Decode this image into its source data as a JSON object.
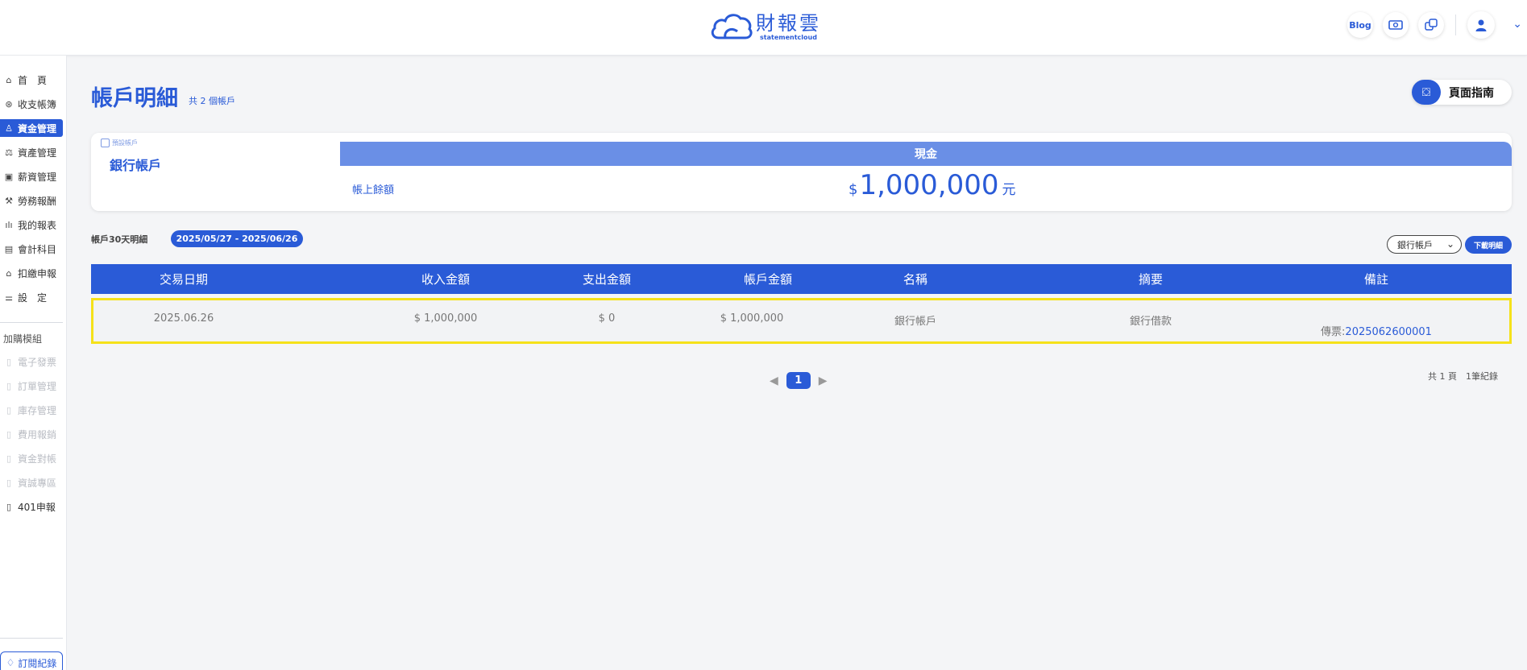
{
  "header": {
    "logo_cn": "財報雲",
    "logo_en": "statementcloud",
    "blog_label": "Blog"
  },
  "sidebar": {
    "items": [
      {
        "label": "首　頁",
        "icon": "home-icon"
      },
      {
        "label": "收支帳簿",
        "icon": "coin-icon"
      },
      {
        "label": "資金管理",
        "icon": "money-hand-icon"
      },
      {
        "label": "資產管理",
        "icon": "scale-icon"
      },
      {
        "label": "薪資管理",
        "icon": "wallet-icon"
      },
      {
        "label": "勞務報酬",
        "icon": "worker-icon"
      },
      {
        "label": "我的報表",
        "icon": "bar-chart-icon"
      },
      {
        "label": "會計科目",
        "icon": "ledger-icon"
      },
      {
        "label": "扣繳申報",
        "icon": "bank-icon"
      },
      {
        "label": "設　定",
        "icon": "sliders-icon"
      }
    ],
    "addon_heading": "加購模組",
    "addon_items": [
      {
        "label": "電子發票",
        "icon": "receipt-icon"
      },
      {
        "label": "訂單管理",
        "icon": "receipt-icon"
      },
      {
        "label": "庫存管理",
        "icon": "receipt-icon"
      },
      {
        "label": "費用報銷",
        "icon": "receipt-icon"
      },
      {
        "label": "資金對帳",
        "icon": "receipt-icon"
      },
      {
        "label": "資誠專區",
        "icon": "receipt-icon"
      },
      {
        "label": "401申報",
        "icon": "receipt-icon"
      }
    ],
    "subscription_label": "訂閱紀錄"
  },
  "main": {
    "title": "帳戶明細",
    "account_count": "共 2 個帳戶",
    "guide_label": "頁面指南",
    "card": {
      "tag": "預設帳戶",
      "account_name": "銀行帳戶",
      "header": "現金",
      "balance_label": "帳上餘額",
      "currency": "$",
      "amount": "1,000,000",
      "unit": "元"
    },
    "period_label": "帳戶30天明細",
    "period_range": "2025/05/27 - 2025/06/26",
    "account_select": "銀行帳戶",
    "download_label": "下載明細",
    "table": {
      "columns": [
        "交易日期",
        "收入金額",
        "支出金額",
        "帳戶金額",
        "名稱",
        "摘要",
        "備註"
      ],
      "rows": [
        {
          "date": "2025.06.26",
          "income": "$ 1,000,000",
          "expense": "$ 0",
          "balance": "$ 1,000,000",
          "name": "銀行帳戶",
          "summary": "銀行借款",
          "note_prefix": "傳票:",
          "note_link": "2025062600001"
        }
      ]
    },
    "pager": {
      "current": "1",
      "info": "共 1 頁　1筆紀錄"
    }
  },
  "colors": {
    "primary": "#2a5bd7",
    "card_header": "#6a8fe6",
    "highlight_border": "#f5e11a"
  }
}
